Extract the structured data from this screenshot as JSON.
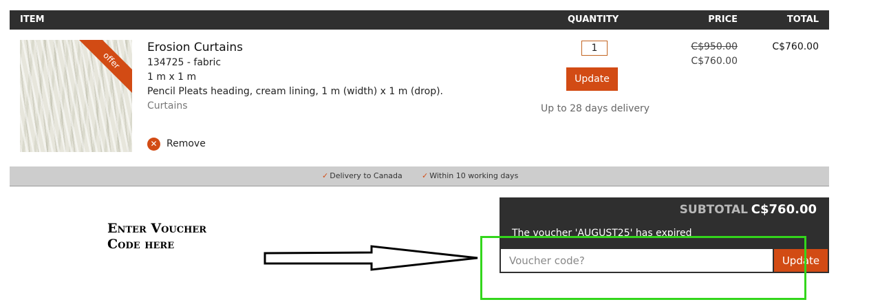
{
  "table_header": {
    "item": "ITEM",
    "quantity": "QUANTITY",
    "price": "PRICE",
    "total": "TOTAL"
  },
  "product": {
    "badge": "offer",
    "name": "Erosion Curtains",
    "sku": "134725 - fabric",
    "size": "1 m x 1 m",
    "description": "Pencil Pleats heading, cream lining, 1 m (width) x 1 m (drop).",
    "category": "Curtains",
    "remove_label": "Remove",
    "remove_icon": "close-circle-icon",
    "quantity": "1",
    "update_label": "Update",
    "delivery_time": "Up to 28 days delivery",
    "original_price": "C$950.00",
    "sale_price": "C$760.00",
    "line_total": "C$760.00"
  },
  "delivery_info": {
    "items": [
      "Delivery to Canada",
      "Within 10 working days"
    ],
    "check_icon": "checkmark-icon"
  },
  "summary": {
    "subtotal_label": "SUBTOTAL",
    "subtotal_value": "C$760.00",
    "voucher_message": "The voucher 'AUGUST25' has expired",
    "voucher_placeholder": "Voucher code?",
    "update_label": "Update"
  },
  "annotation": {
    "line1": "Enter Voucher",
    "line2": "Code here",
    "arrow_icon": "right-arrow-icon"
  },
  "colors": {
    "accent": "#d24b14",
    "header_bg": "#2f2f2f",
    "info_bar_bg": "#cdcdcd",
    "highlight_box": "#33d61c"
  }
}
